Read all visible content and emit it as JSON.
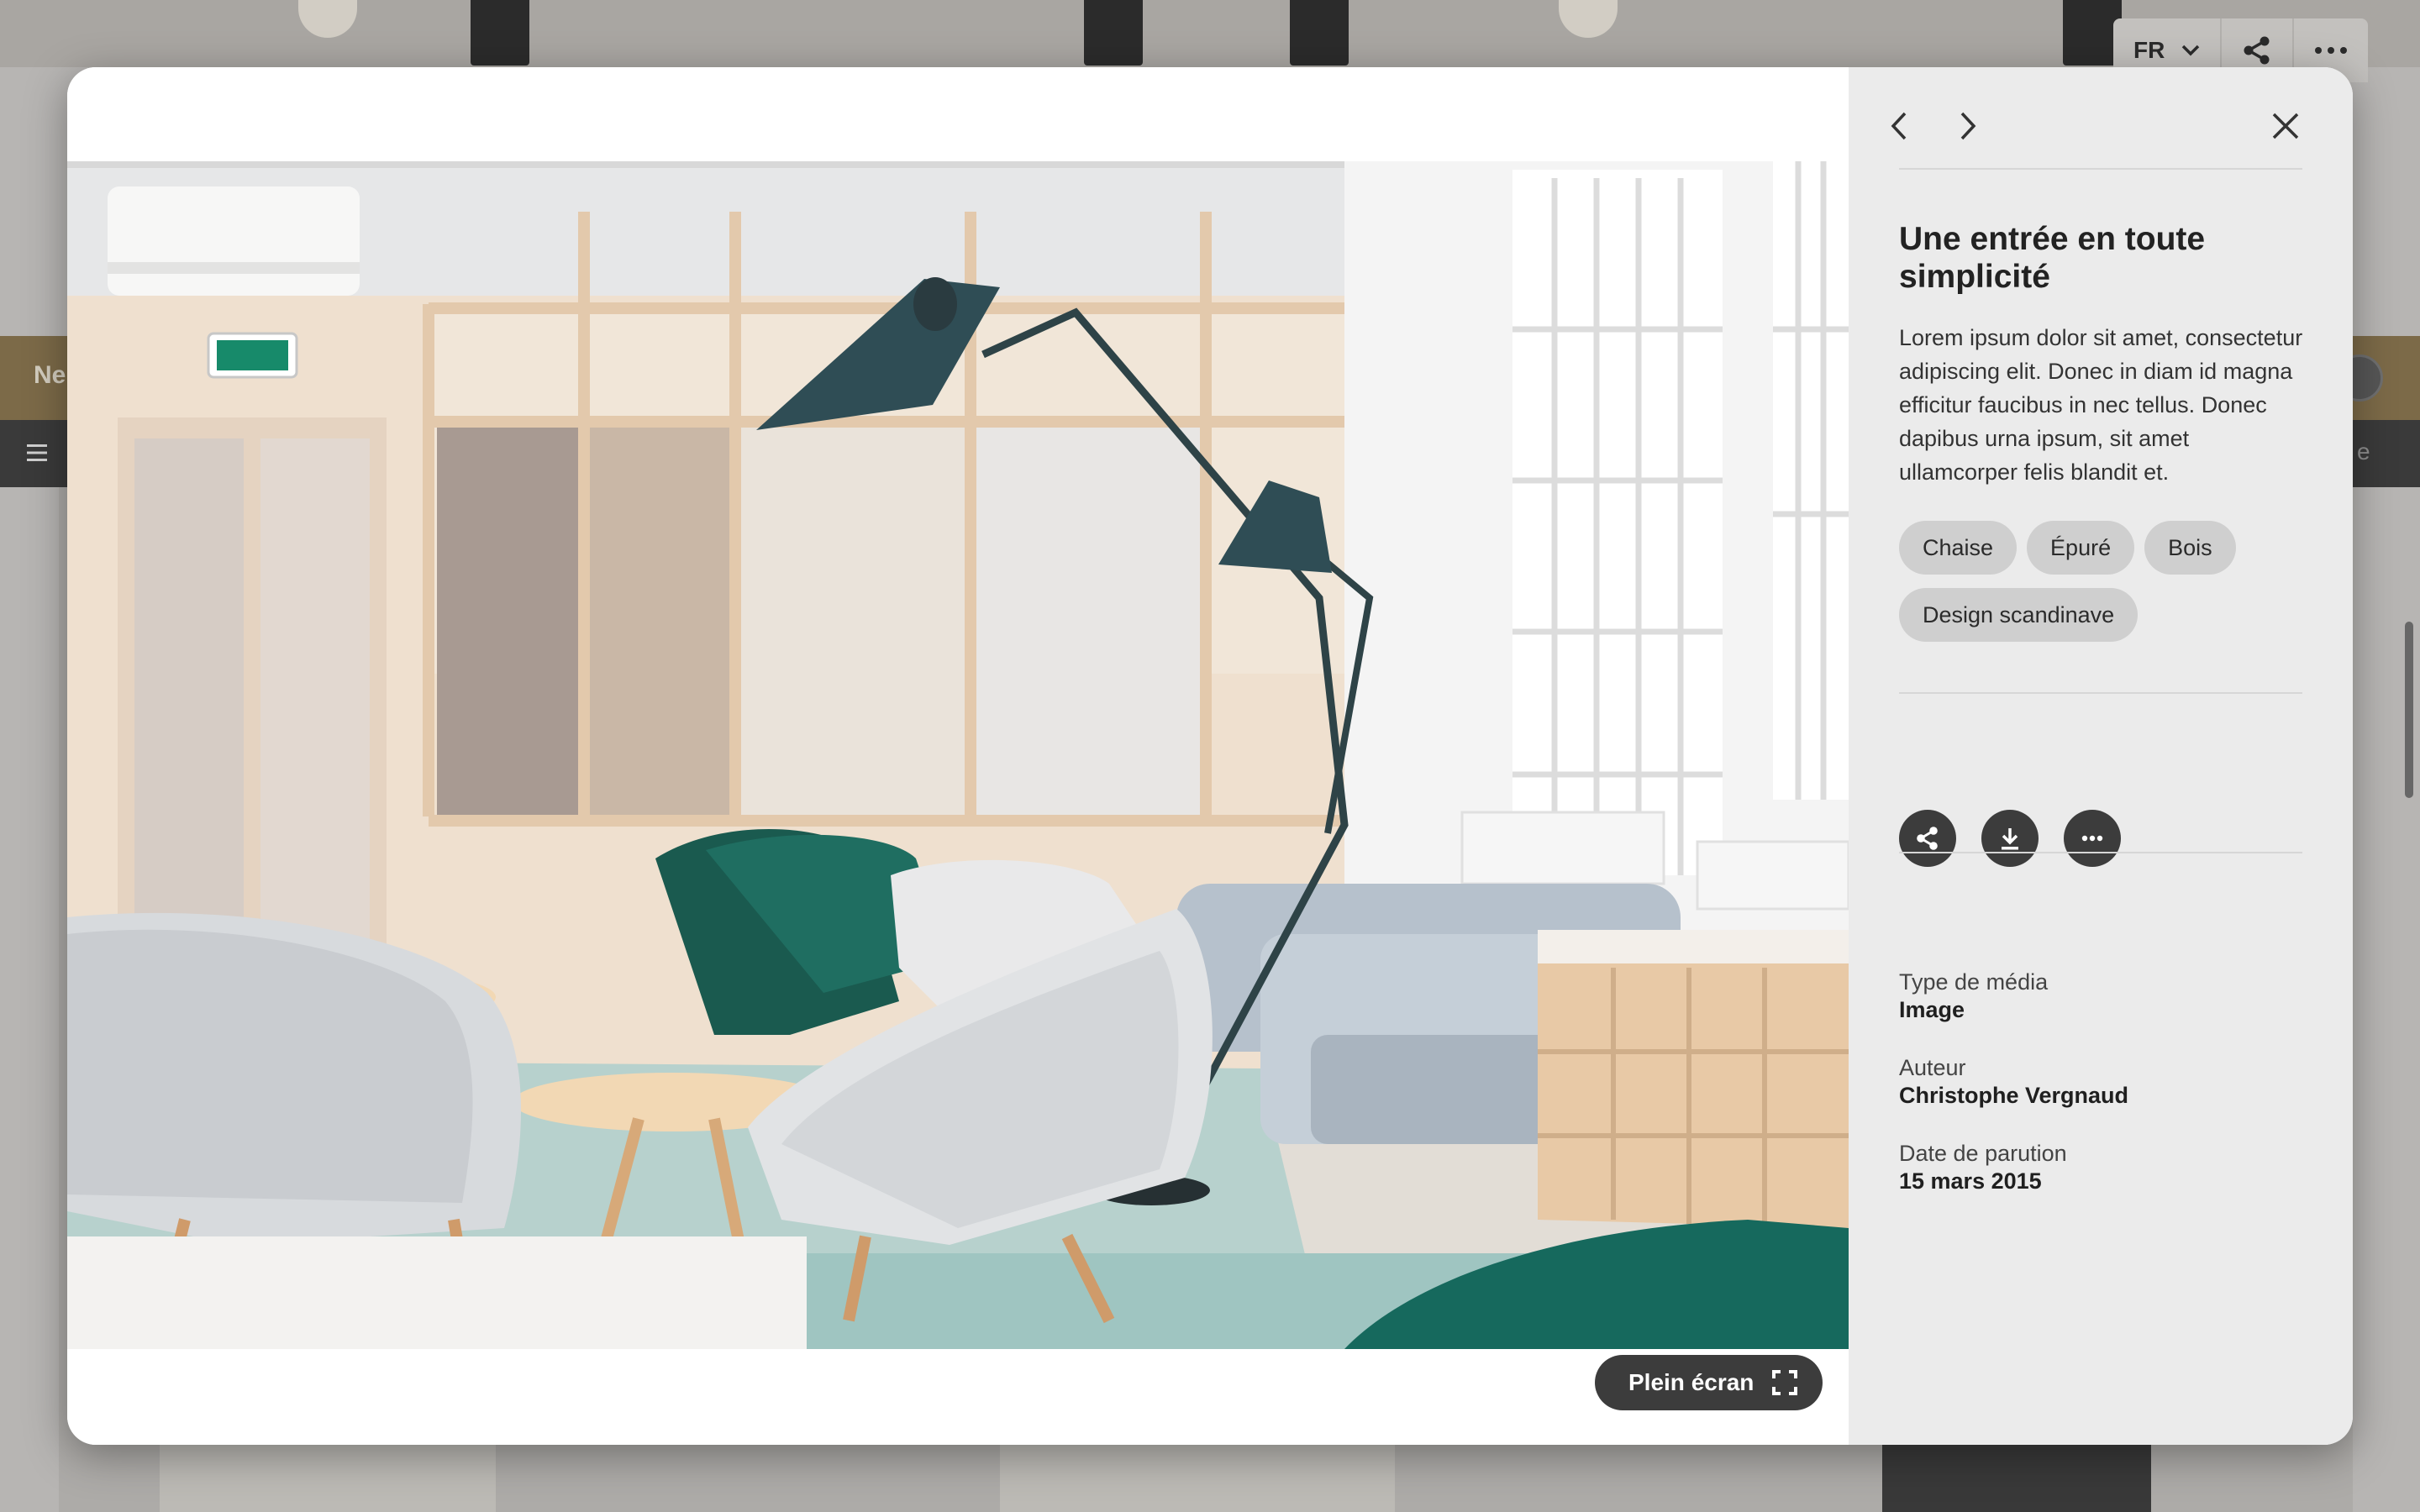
{
  "background_page": {
    "band_text": "Ne",
    "bar_right_text": "e",
    "top_controls": {
      "language": "FR"
    }
  },
  "viewer": {
    "fullscreen_label": "Plein écran"
  },
  "panel": {
    "title": "Une entrée en toute simplicité",
    "description": "Lorem ipsum dolor sit amet, consectetur adipiscing elit. Donec in diam id magna efficitur faucibus in nec tellus. Donec dapibus urna ipsum, sit amet ullamcorper felis blandit et.",
    "tags": [
      {
        "label": "Chaise"
      },
      {
        "label": "Épuré"
      },
      {
        "label": "Bois"
      },
      {
        "label": "Design scandinave"
      }
    ],
    "meta": [
      {
        "label": "Type de média",
        "value": "Image"
      },
      {
        "label": "Auteur",
        "value": "Christophe Vergnaud"
      },
      {
        "label": "Date de parution",
        "value": "15 mars 2015"
      }
    ]
  },
  "colors": {
    "panel_bg": "#ebebeb",
    "dark_button": "#3c3c3c",
    "tag_bg": "#cfcfcf",
    "band": "#86714a"
  },
  "icons": [
    "chevron-left-icon",
    "chevron-right-icon",
    "close-icon",
    "share-icon",
    "download-icon",
    "more-icon",
    "expand-icon",
    "chevron-down-icon",
    "hamburger-icon"
  ]
}
